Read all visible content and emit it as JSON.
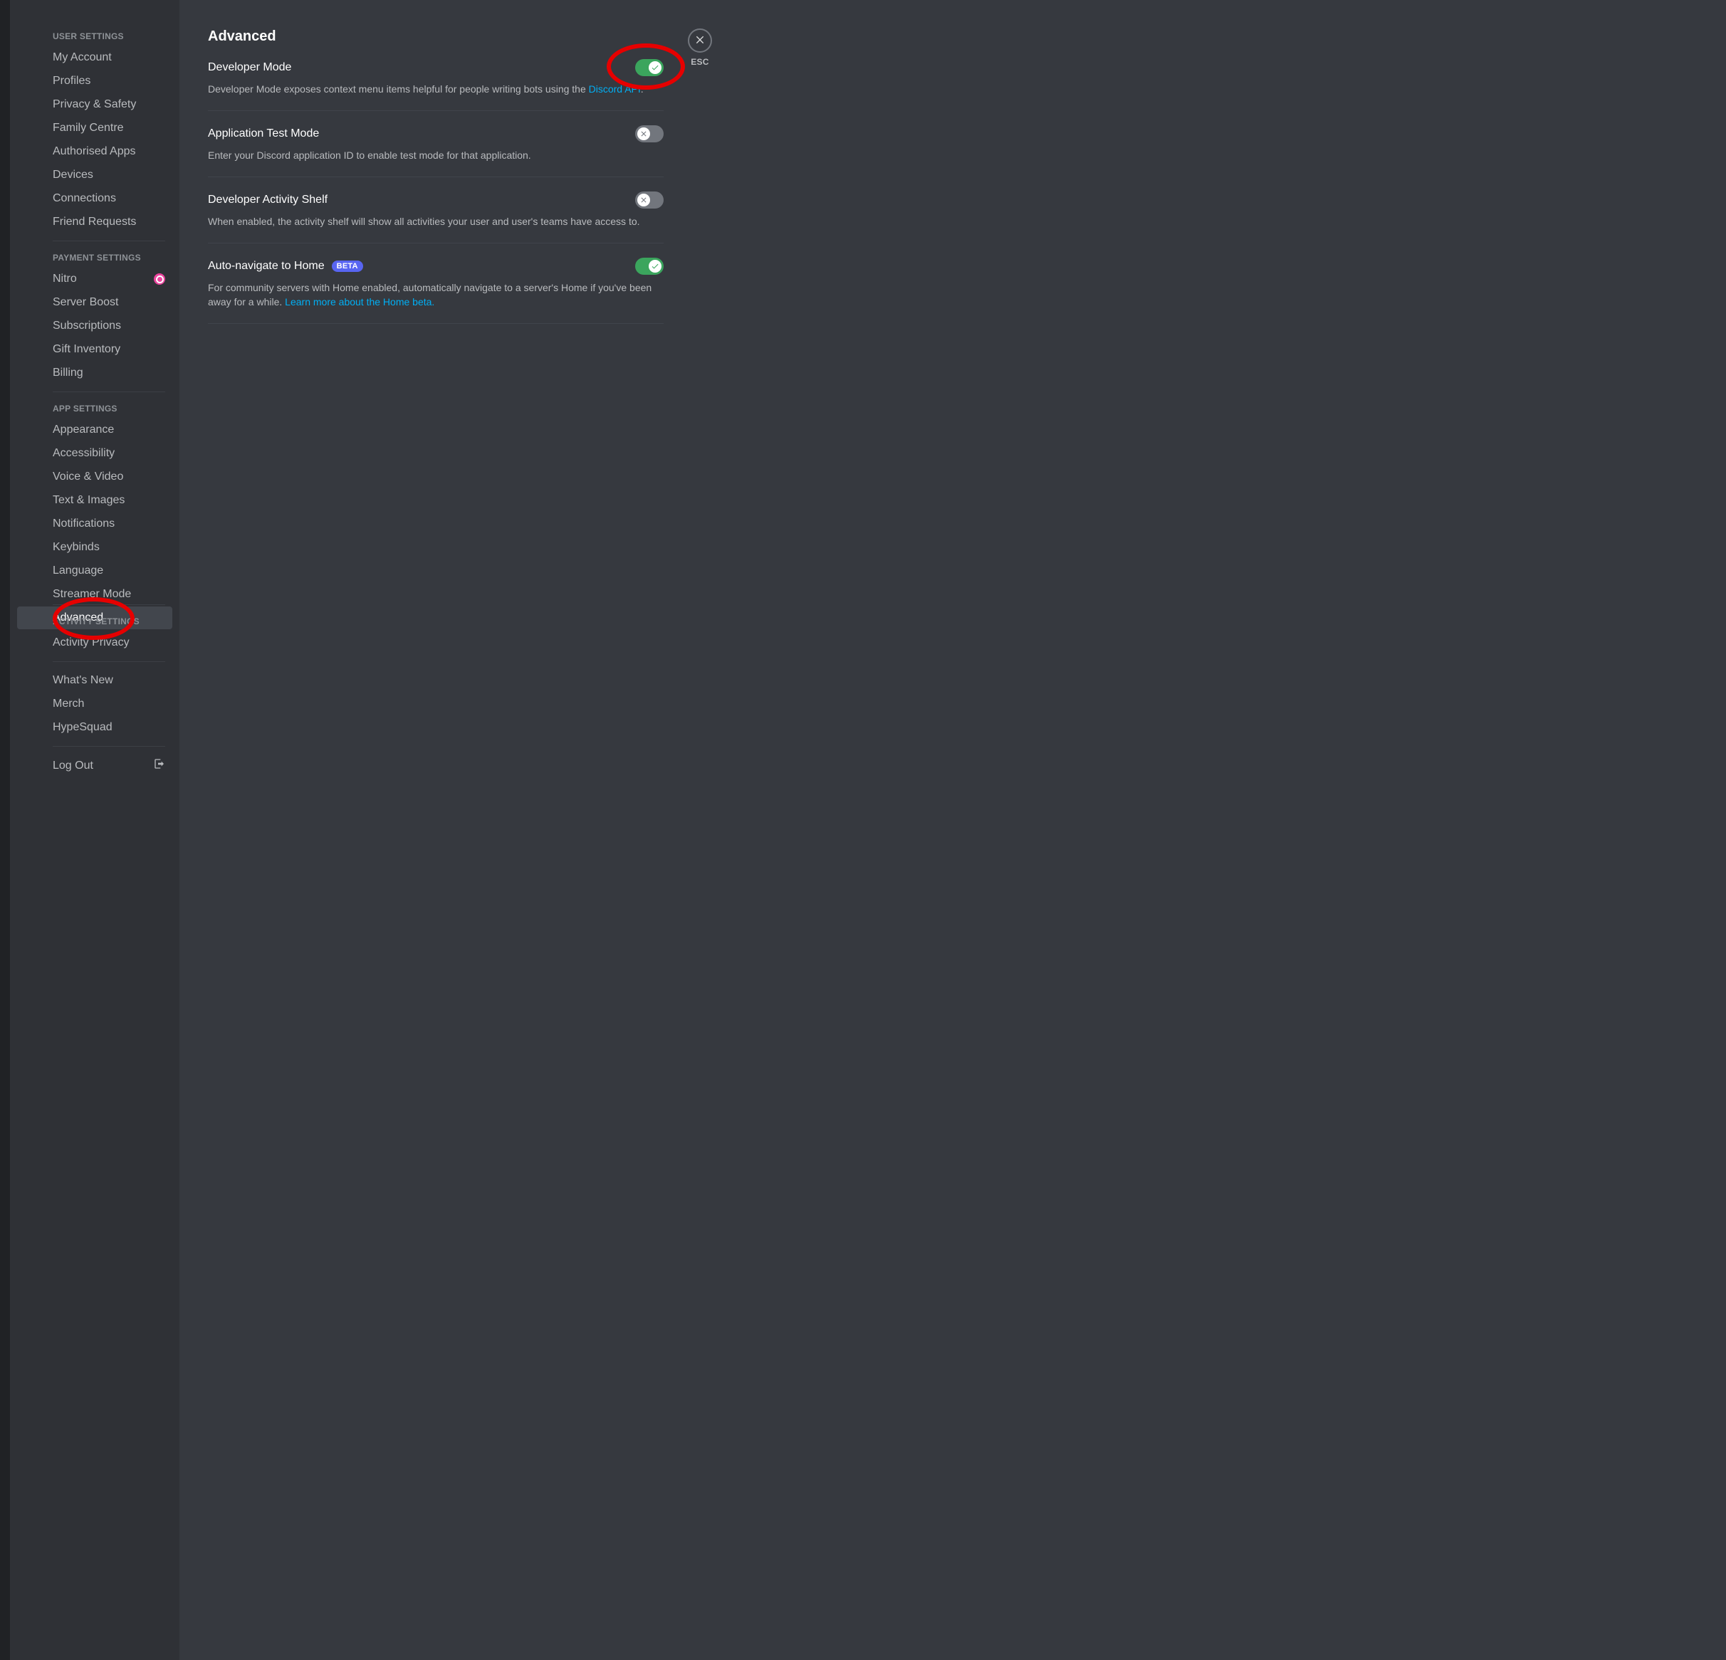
{
  "sidebar": {
    "sections": [
      {
        "header": "USER SETTINGS",
        "items": [
          "My Account",
          "Profiles",
          "Privacy & Safety",
          "Family Centre",
          "Authorised Apps",
          "Devices",
          "Connections",
          "Friend Requests"
        ]
      },
      {
        "header": "PAYMENT SETTINGS",
        "items": [
          "Nitro",
          "Server Boost",
          "Subscriptions",
          "Gift Inventory",
          "Billing"
        ],
        "nitro_index": 0
      },
      {
        "header": "APP SETTINGS",
        "items": [
          "Appearance",
          "Accessibility",
          "Voice & Video",
          "Text & Images",
          "Notifications",
          "Keybinds",
          "Language",
          "Streamer Mode",
          "Advanced"
        ],
        "selected": "Advanced"
      },
      {
        "header": "ACTIVITY SETTINGS",
        "items": [
          "Activity Privacy"
        ]
      },
      {
        "header": "",
        "items": [
          "What's New",
          "Merch",
          "HypeSquad"
        ]
      },
      {
        "header": "",
        "items": [
          "Log Out"
        ],
        "logout_index": 0
      }
    ]
  },
  "page": {
    "title": "Advanced",
    "close_label": "ESC",
    "settings": [
      {
        "key": "developer_mode",
        "label": "Developer Mode",
        "desc_pre": "Developer Mode exposes context menu items helpful for people writing bots using the ",
        "link_text": "Discord API",
        "desc_post": ".",
        "on": true,
        "annotated": true
      },
      {
        "key": "app_test_mode",
        "label": "Application Test Mode",
        "desc_pre": "Enter your Discord application ID to enable test mode for that application.",
        "link_text": "",
        "desc_post": "",
        "on": false
      },
      {
        "key": "dev_activity_shelf",
        "label": "Developer Activity Shelf",
        "desc_pre": "When enabled, the activity shelf will show all activities your user and user's teams have access to.",
        "link_text": "",
        "desc_post": "",
        "on": false
      },
      {
        "key": "auto_navigate_home",
        "label": "Auto-navigate to Home",
        "badge": "BETA",
        "desc_pre": "For community servers with Home enabled, automatically navigate to a server's Home if you've been away for a while. ",
        "link_text": "Learn more about the Home beta.",
        "desc_post": "",
        "on": true
      }
    ]
  }
}
